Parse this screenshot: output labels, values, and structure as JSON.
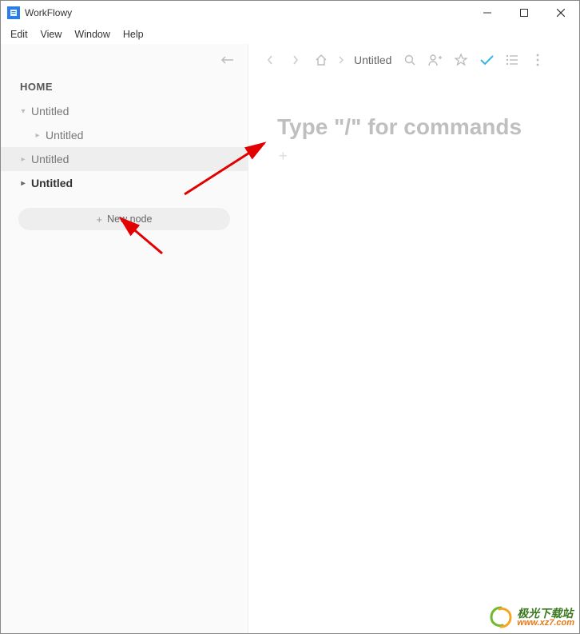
{
  "window": {
    "title": "WorkFlowy"
  },
  "menu": {
    "edit": "Edit",
    "view": "View",
    "window": "Window",
    "help": "Help"
  },
  "sidebar": {
    "home": "HOME",
    "items": [
      {
        "label": "Untitled"
      },
      {
        "label": "Untitled"
      },
      {
        "label": "Untitled"
      },
      {
        "label": "Untitled"
      }
    ],
    "new_node": "New node"
  },
  "breadcrumb": {
    "current": "Untitled"
  },
  "document": {
    "placeholder": "Type \"/\" for commands"
  },
  "watermark": {
    "cn": "极光下载站",
    "url": "www.xz7.com"
  }
}
